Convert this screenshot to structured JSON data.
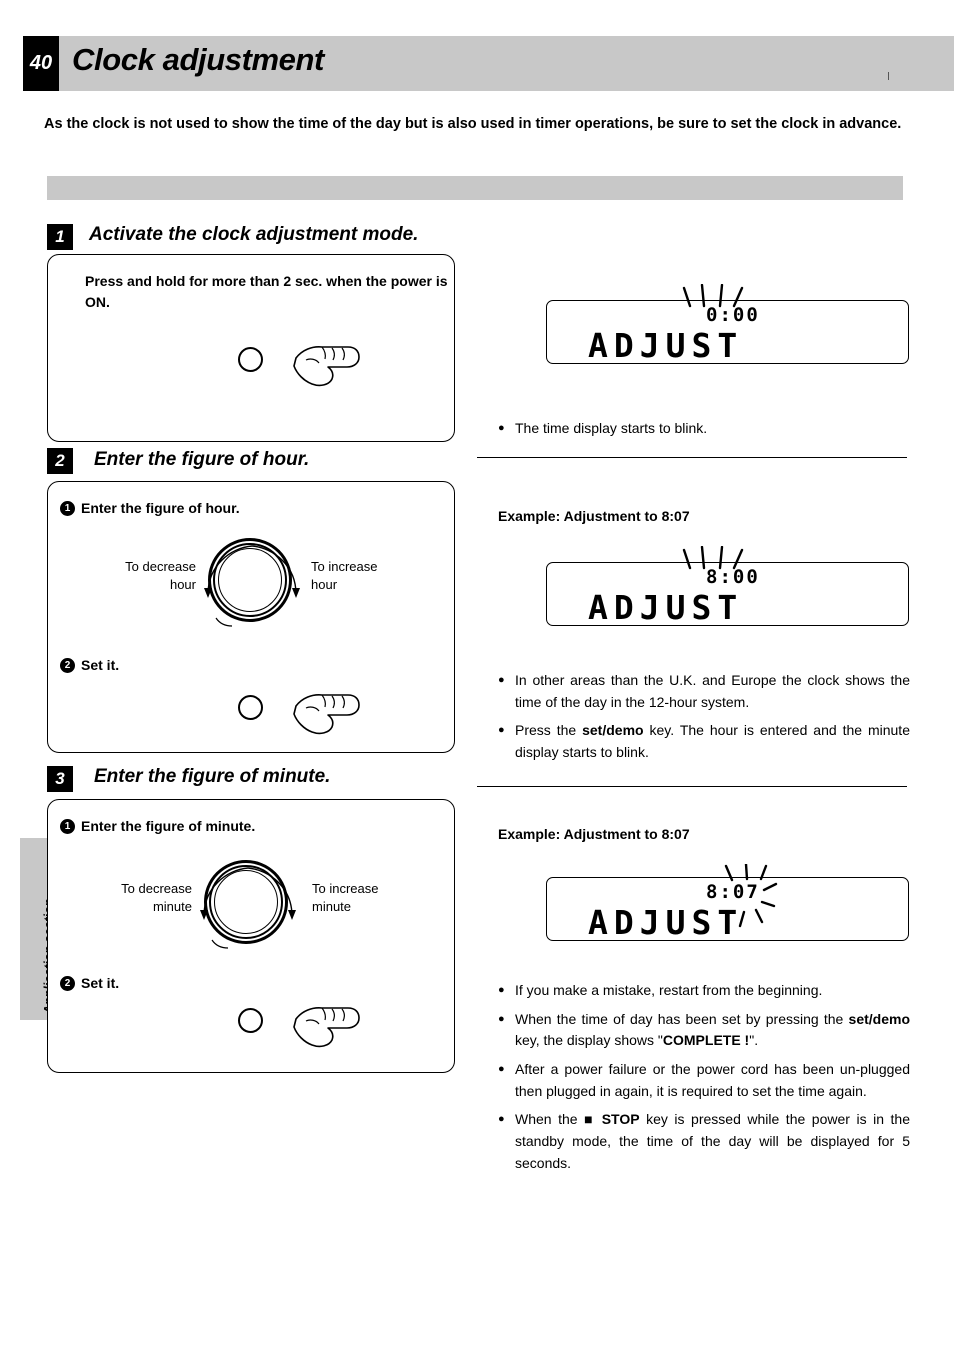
{
  "page": {
    "number": "40",
    "title": "Clock adjustment",
    "side_tab": "Application section",
    "intro": "As the clock is not used to show the time of the day but is also used in timer operations, be sure to set the clock in advance."
  },
  "steps": [
    {
      "number": "1",
      "title": "Activate the clock adjustment mode.",
      "panel_heading": "Press and hold for more than 2 sec. when the power is ON.",
      "display": {
        "time": "0:00",
        "word": "ADJUST"
      },
      "notes": [
        {
          "text": "The time display starts to blink."
        }
      ]
    },
    {
      "number": "2",
      "title": "Enter the figure of hour.",
      "sub1": {
        "marker": "1",
        "label": "Enter the figure of hour."
      },
      "sub2": {
        "marker": "2",
        "label": "Set it."
      },
      "knob_left": "To decrease\nhour",
      "knob_right": "To increase\nhour",
      "example_label": "Example: Adjustment to 8:07",
      "display": {
        "time": "8:00",
        "word": "ADJUST"
      },
      "notes": [
        {
          "text": "In other areas than the U.K. and Europe the clock shows the time of the day in the 12-hour system."
        },
        {
          "text": "Press the set/demo key. The hour is entered and the minute display starts to blink."
        }
      ]
    },
    {
      "number": "3",
      "title": "Enter the figure of minute.",
      "sub1": {
        "marker": "1",
        "label": "Enter the figure of minute."
      },
      "sub2": {
        "marker": "2",
        "label": "Set it."
      },
      "knob_left": "To decrease\nminute",
      "knob_right": "To increase\nminute",
      "example_label": "Example: Adjustment to 8:07",
      "display": {
        "time": "8:07",
        "word": "ADJUST"
      },
      "notes": [
        {
          "text": "If you make a mistake, restart from the beginning."
        },
        {
          "text": "When the time of day has been set by pressing the set/demo key, the display shows \"COMPLETE !\"."
        },
        {
          "text": "After a power failure or the power cord has been un-plugged then plugged in again, it is required to set the time again."
        },
        {
          "text": "When the ■ STOP key is pressed while the power is in the standby mode, the time of the day will be displayed for 5 seconds."
        }
      ]
    }
  ],
  "colors": {
    "band": "#c8c8c8",
    "ink": "#000000",
    "paper": "#ffffff"
  }
}
